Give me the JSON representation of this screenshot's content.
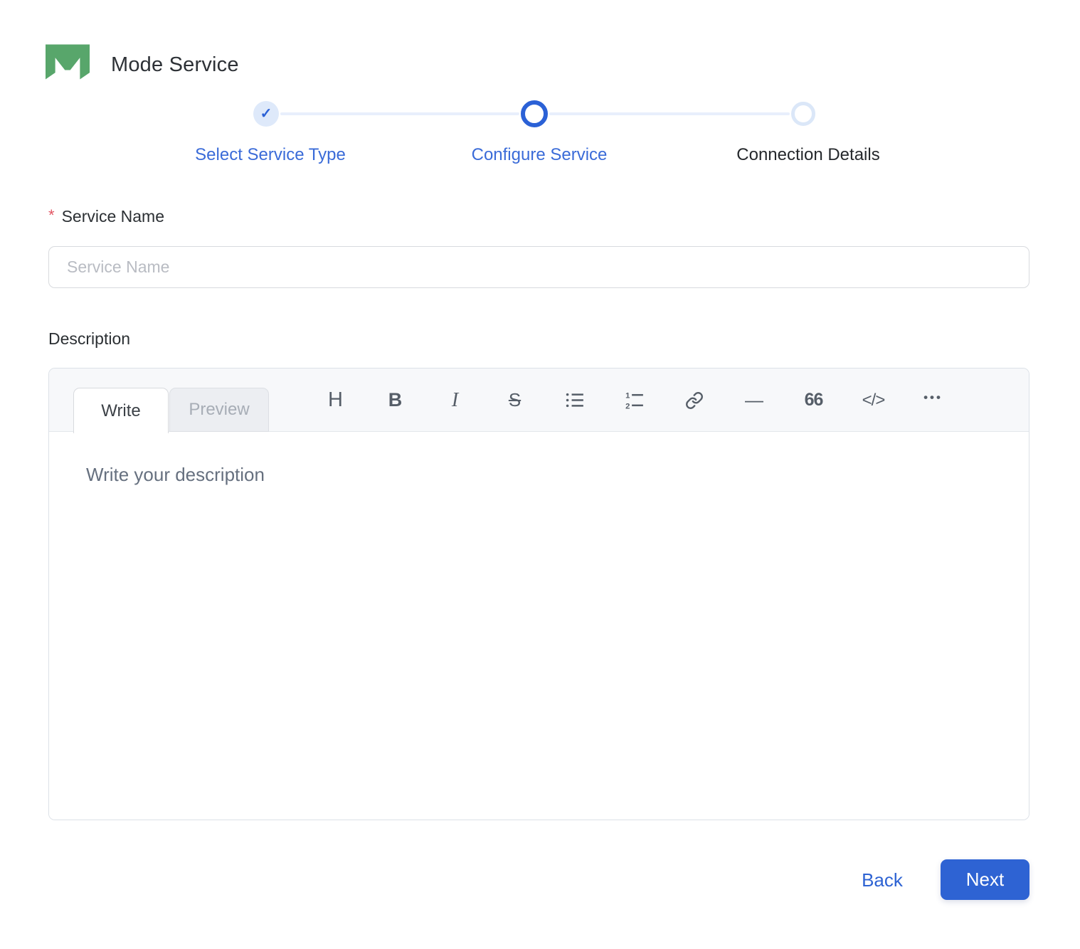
{
  "app": {
    "title": "Mode Service"
  },
  "icons": {
    "check": "✓"
  },
  "stepper": {
    "steps": [
      {
        "label": "Select Service Type",
        "state": "completed"
      },
      {
        "label": "Configure Service",
        "state": "active"
      },
      {
        "label": "Connection Details",
        "state": "upcoming"
      }
    ]
  },
  "form": {
    "service_name": {
      "label": "Service Name",
      "required_marker": "*",
      "placeholder": "Service Name",
      "value": ""
    },
    "description": {
      "label": "Description",
      "editor": {
        "tabs": [
          {
            "label": "Write",
            "active": true
          },
          {
            "label": "Preview",
            "active": false
          }
        ],
        "placeholder": "Write your description",
        "toolbar_glyphs": {
          "heading": "H",
          "bold": "B",
          "italic": "I",
          "strikethrough": "S",
          "horizontal_rule": "—",
          "quote": "66",
          "code": "</>",
          "more": "•••"
        },
        "toolbar_items": [
          "heading",
          "bold",
          "italic",
          "strikethrough",
          "unordered-list",
          "ordered-list",
          "link",
          "horizontal-rule",
          "quote",
          "code",
          "more"
        ]
      }
    }
  },
  "footer": {
    "back_label": "Back",
    "next_label": "Next"
  },
  "colors": {
    "accent": "#2e63d3",
    "step_completed_bg": "#dee9fa",
    "step_track": "#e8effc",
    "logo_green": "#58a66b",
    "required": "#e25563",
    "editor_header_bg": "#f7f8fa",
    "icon_gray": "#565e68"
  }
}
